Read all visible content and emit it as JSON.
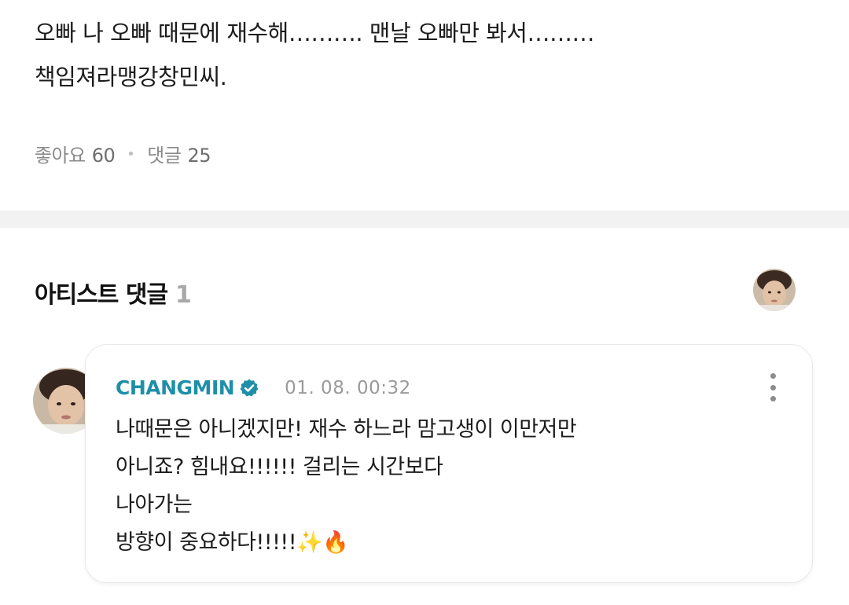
{
  "post": {
    "body_lines": [
      "오빠 나 오빠 때문에 재수해………. 맨날 오빠만 봐서………",
      "책임져라맹강창민씨."
    ],
    "likes_label": "좋아요",
    "likes_count": "60",
    "comments_label": "댓글",
    "comments_count": "25"
  },
  "artist_comments": {
    "title": "아티스트 댓글",
    "count": "1",
    "comment": {
      "author": "CHANGMIN",
      "timestamp": "01. 08. 00:32",
      "body_lines": [
        "나때문은 아니겠지만! 재수 하느라 맘고생이 이만저만",
        "아니죠? 힘내요!!!!!! 걸리는 시간보다",
        "나아가는",
        "방향이 중요하다!!!!!✨🔥"
      ]
    }
  },
  "icons": {
    "verified": "verified-badge-icon",
    "more": "more-vertical-icon"
  },
  "colors": {
    "author": "#1e8fa8",
    "divider": "#f2f2f2",
    "meta": "#8a8a8a"
  }
}
